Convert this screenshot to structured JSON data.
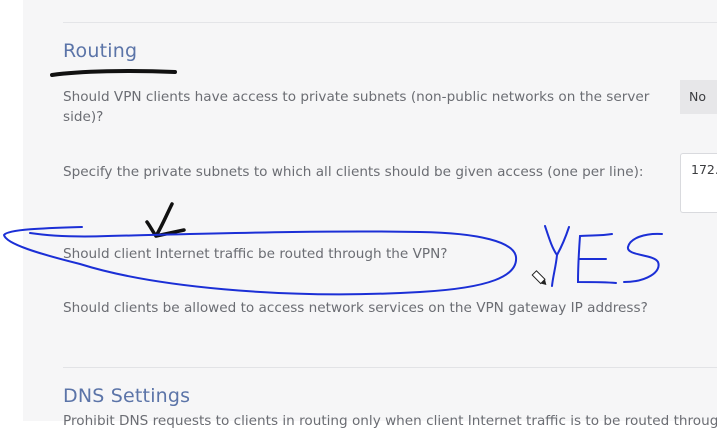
{
  "routing": {
    "title": "Routing",
    "q_private_subnets": "Should VPN clients have access to private subnets (non-public networks on the server side)?",
    "private_subnets_value": "No",
    "q_subnet_list": "Specify the private subnets to which all clients should be given access (one per line):",
    "subnet_list_value": "172.",
    "q_internet_traffic": "Should client Internet traffic be routed through the VPN?",
    "q_gateway_services": "Should clients be allowed to access network services on the VPN gateway IP address?"
  },
  "dns": {
    "title": "DNS Settings",
    "description": "Prohibit DNS requests to clients in routing only when client Internet traffic is to be routed through"
  },
  "annotation": {
    "yes_text": "YES",
    "pen_color": "#1b2fd6",
    "ink_color": "#111111"
  }
}
